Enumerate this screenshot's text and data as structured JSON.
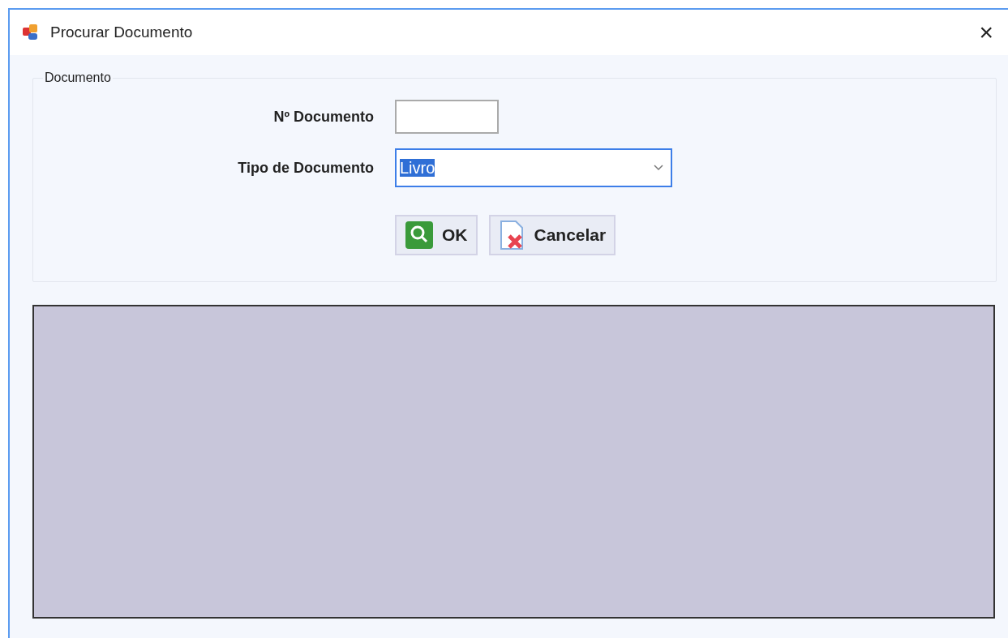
{
  "window": {
    "title": "Procurar Documento",
    "close": "×"
  },
  "group": {
    "title": "Documento",
    "fields": [
      {
        "kind": "text",
        "label": "Nº Documento"
      },
      {
        "kind": "combo",
        "label": "Tipo de Documento",
        "value": "Livro",
        "text_selected": true
      }
    ],
    "buttons": [
      {
        "kind": "search",
        "label": "OK"
      },
      {
        "kind": "cancel",
        "label": "Cancelar"
      }
    ]
  },
  "results": {
    "kind": "grid"
  }
}
